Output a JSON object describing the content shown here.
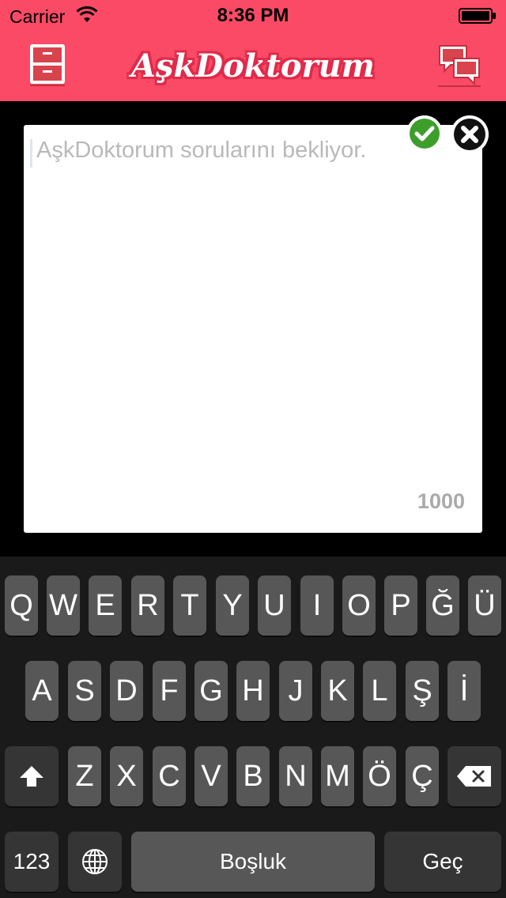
{
  "status_bar": {
    "carrier": "Carrier",
    "time": "8:36 PM"
  },
  "nav": {
    "logo_text": "AşkDoktorum",
    "left_icon": "drawer-icon",
    "right_icon": "chat-bubbles-icon"
  },
  "composer": {
    "placeholder": "AşkDoktorum sorularını bekliyor.",
    "value": "",
    "char_count": "1000",
    "confirm_icon": "checkmark-icon",
    "cancel_icon": "close-icon"
  },
  "keyboard": {
    "row1": [
      "Q",
      "W",
      "E",
      "R",
      "T",
      "Y",
      "U",
      "I",
      "O",
      "P",
      "Ğ",
      "Ü"
    ],
    "row2": [
      "A",
      "S",
      "D",
      "F",
      "G",
      "H",
      "J",
      "K",
      "L",
      "Ş",
      "İ"
    ],
    "row3": [
      "Z",
      "X",
      "C",
      "V",
      "B",
      "N",
      "M",
      "Ö",
      "Ç"
    ],
    "numbers_label": "123",
    "space_label": "Boşluk",
    "return_label": "Geç",
    "shift_icon": "shift-icon",
    "globe_icon": "globe-icon",
    "backspace_icon": "backspace-icon"
  },
  "colors": {
    "brand": "#fb4a66",
    "brand_dark": "#e02a4a",
    "confirm_green": "#3e9e2c",
    "keyboard_bg": "#1a1a1a",
    "key_bg": "#575757",
    "key_dark_bg": "#353535"
  }
}
